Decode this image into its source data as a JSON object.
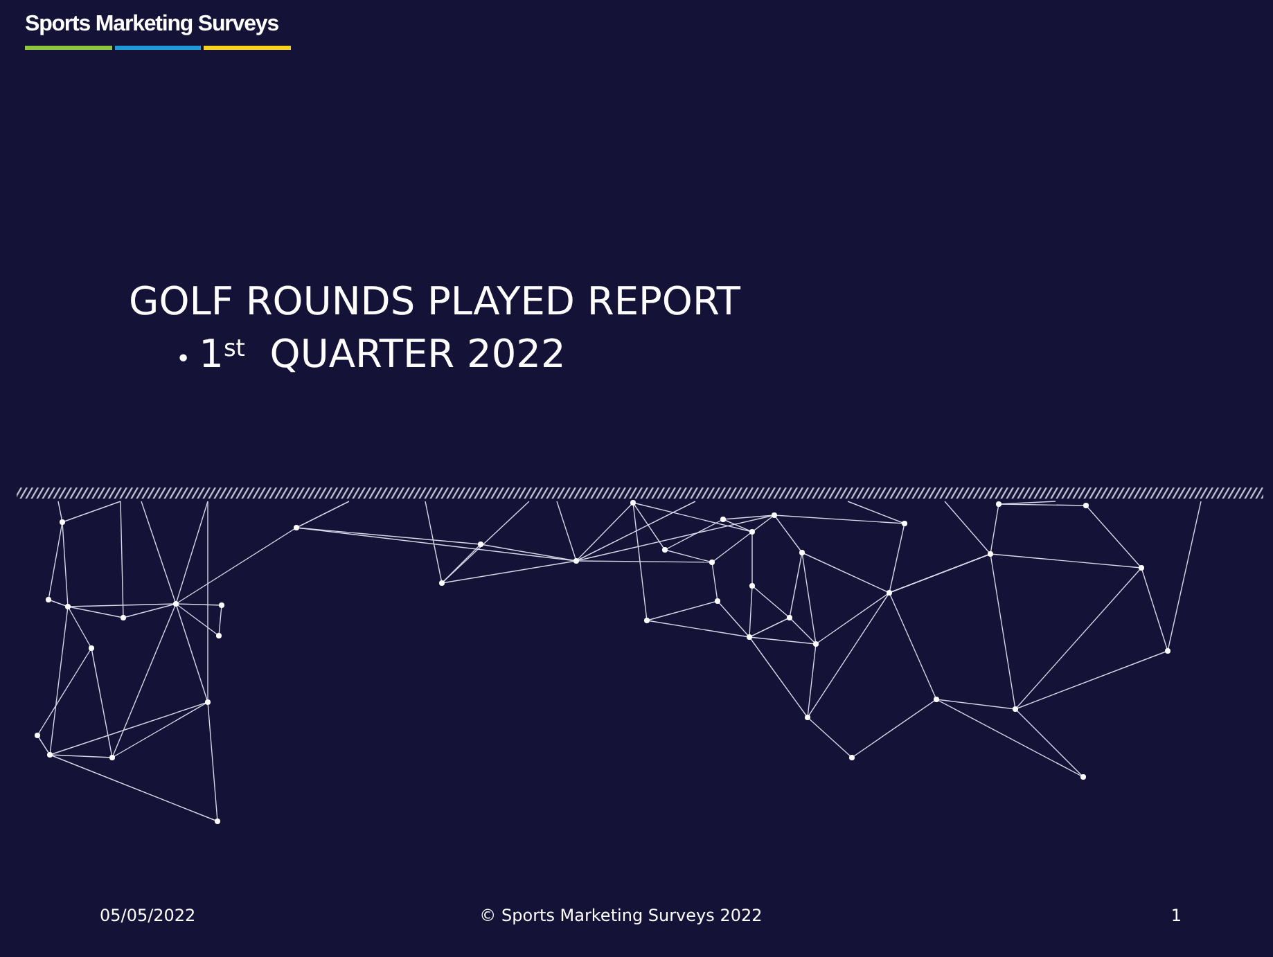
{
  "logo": {
    "text": "Sports Marketing Surveys"
  },
  "title": "GOLF ROUNDS PLAYED REPORT",
  "subtitle": {
    "bullet": "•",
    "text": "1$^{st}$  QUARTER 2022"
  },
  "footer": {
    "date": "05/05/2022",
    "copyright": "© Sports Marketing Surveys 2022",
    "page": "1"
  }
}
